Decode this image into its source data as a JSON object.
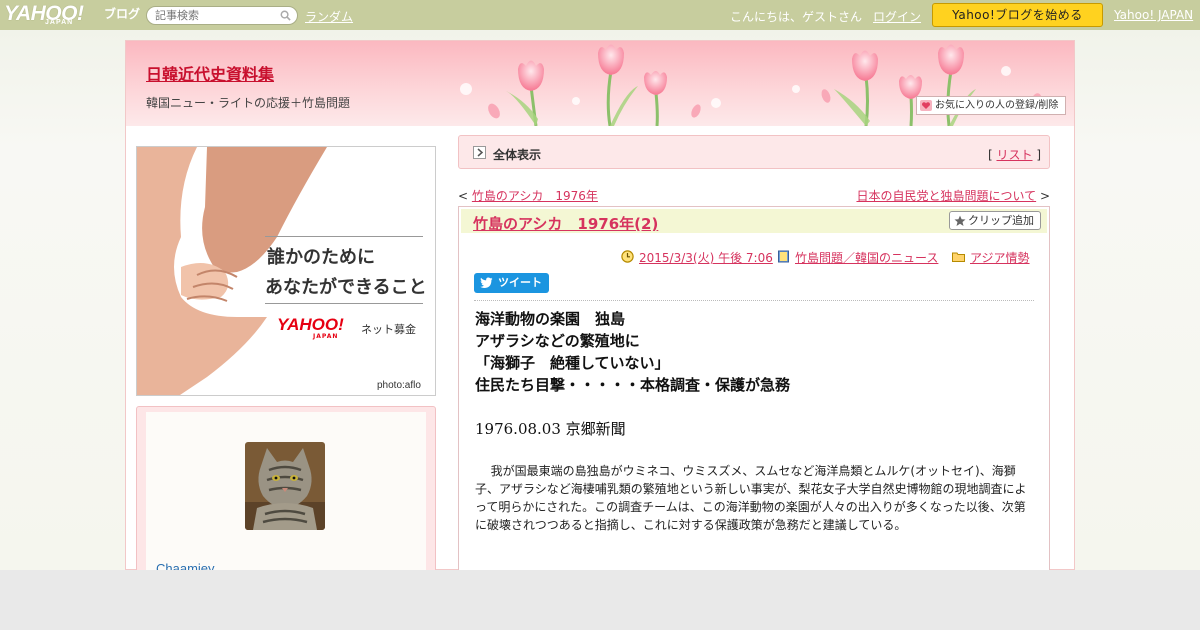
{
  "topbar": {
    "logo_yahoo": "YAHOO!",
    "logo_japan": "JAPAN",
    "logo_blog": "ブログ",
    "search_placeholder": "記事検索",
    "random_label": "ランダム",
    "greeting": "こんにちは、ゲストさん",
    "login_label": "ログイン",
    "start_blog_label": "Yahoo!ブログを始める",
    "yahoo_japan_link": "Yahoo! JAPAN"
  },
  "header": {
    "blog_title": "日韓近代史資料集",
    "blog_description": "韓国ニュー・ライトの応援＋竹島問題",
    "favorite_button": "お気に入りの人の登録/削除"
  },
  "ad": {
    "line1": "誰かのために",
    "line2": "あなたができること",
    "brand": "YAHOO!",
    "brand_sub": "JAPAN",
    "service": "ネット募金",
    "credit": "photo:aflo"
  },
  "profile": {
    "username": "Chaamiey"
  },
  "viewbar": {
    "label": "全体表示",
    "list_open": "[ ",
    "list_link": "リスト",
    "list_close": " ]"
  },
  "nav": {
    "prev_arrow": "< ",
    "prev_title": "竹島のアシカ　1976年",
    "next_title": "日本の自民党と独島問題について",
    "next_arrow": " >"
  },
  "article": {
    "title": "竹島のアシカ　1976年(2)",
    "clip_label": "クリップ追加",
    "date": "2015/3/3(火) 午後 7:06",
    "category": "竹島問題／韓国のニュース",
    "folder": "アジア情勢",
    "tweet_label": "ツイート",
    "headline": [
      "海洋動物の楽園　独島",
      "アザラシなどの繁殖地に",
      "「海獅子　絶種していない」",
      "住民たち目撃・・・・・本格調査・保護が急務"
    ],
    "dateline": "1976.08.03 京郷新聞",
    "body": "我が国最東端の島独島がウミネコ、ウミスズメ、スムセなど海洋鳥類とムルケ(オットセイ)、海獅子、アザラシなど海棲哺乳類の繁殖地という新しい事実が、梨花女子大学自然史博物館の現地調査によって明らかにされた。この調査チームは、この海洋動物の楽園が人々の出入りが多くなった以後、次第に破壊されつつあると指摘し、これに対する保護政策が急務だと建議している。"
  },
  "colors": {
    "topbar": "#c7cd9e",
    "accent_link": "#d6335e",
    "title_red": "#c8102e",
    "start_button": "#ffd21f",
    "article_header": "#f4f7d4",
    "pink_panel": "#fde8e9"
  },
  "icons": [
    "search-icon",
    "arrow-icon",
    "clock-icon",
    "book-icon",
    "folder-icon",
    "star-icon",
    "heart-icon",
    "bird-icon"
  ]
}
